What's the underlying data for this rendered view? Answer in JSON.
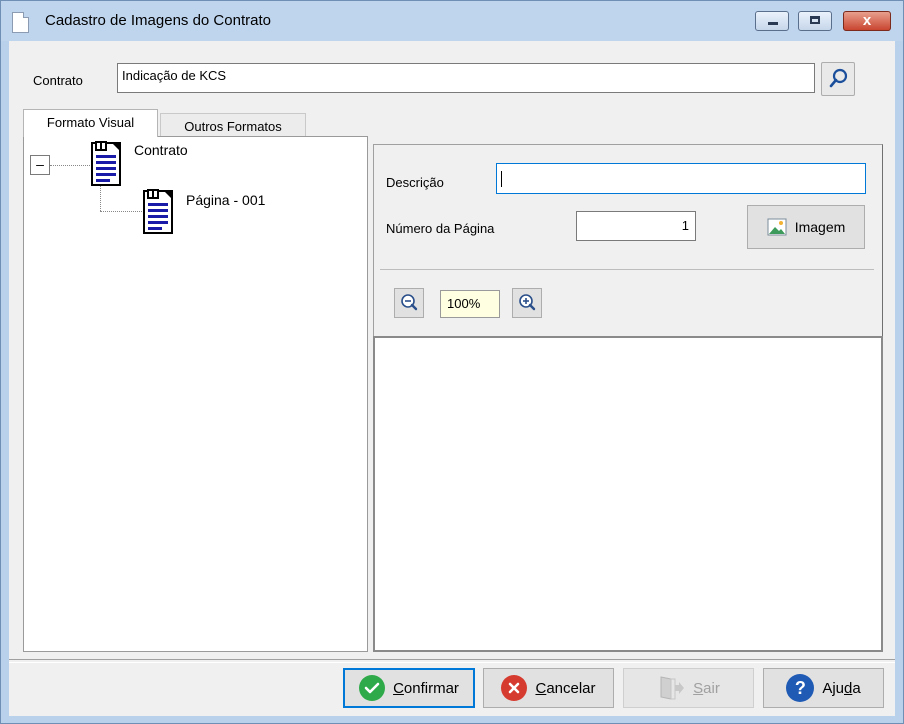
{
  "window": {
    "title": "Cadastro de Imagens do Contrato",
    "close_glyph": "x",
    "close_color": "#c94530"
  },
  "contrato": {
    "label": "Contrato",
    "value": "Indicação de KCS"
  },
  "tabs": [
    {
      "label": "Formato Visual",
      "active": true
    },
    {
      "label": "Outros Formatos",
      "active": false
    }
  ],
  "tree": {
    "collapse_glyph": "–",
    "root_label": "Contrato",
    "child_label": "Página - 001"
  },
  "form": {
    "descricao_label": "Descrição",
    "descricao_value": "",
    "numero_label": "Número da Página",
    "numero_value": "1",
    "imagem_button": "Imagem"
  },
  "zoom": {
    "value": "100%"
  },
  "buttons": {
    "confirmar_prefix": "C",
    "confirmar_rest": "onfirmar",
    "cancelar_prefix": "C",
    "cancelar_rest": "ancelar",
    "sair_prefix": "S",
    "sair_rest": "air",
    "ajuda_prefix": "Aju",
    "ajuda_under": "d",
    "ajuda_rest": "a",
    "confirmar_color": "#2eaa4a",
    "cancelar_color": "#d63b2f",
    "ajuda_color": "#1f5bb5"
  },
  "icons": {
    "search": "search-icon",
    "document": "document-icon",
    "image": "image-icon",
    "zoom_out": "zoom-out-icon",
    "zoom_in": "zoom-in-icon",
    "check": "check-icon",
    "cancel": "cancel-icon",
    "exit": "exit-icon",
    "help": "help-icon"
  }
}
